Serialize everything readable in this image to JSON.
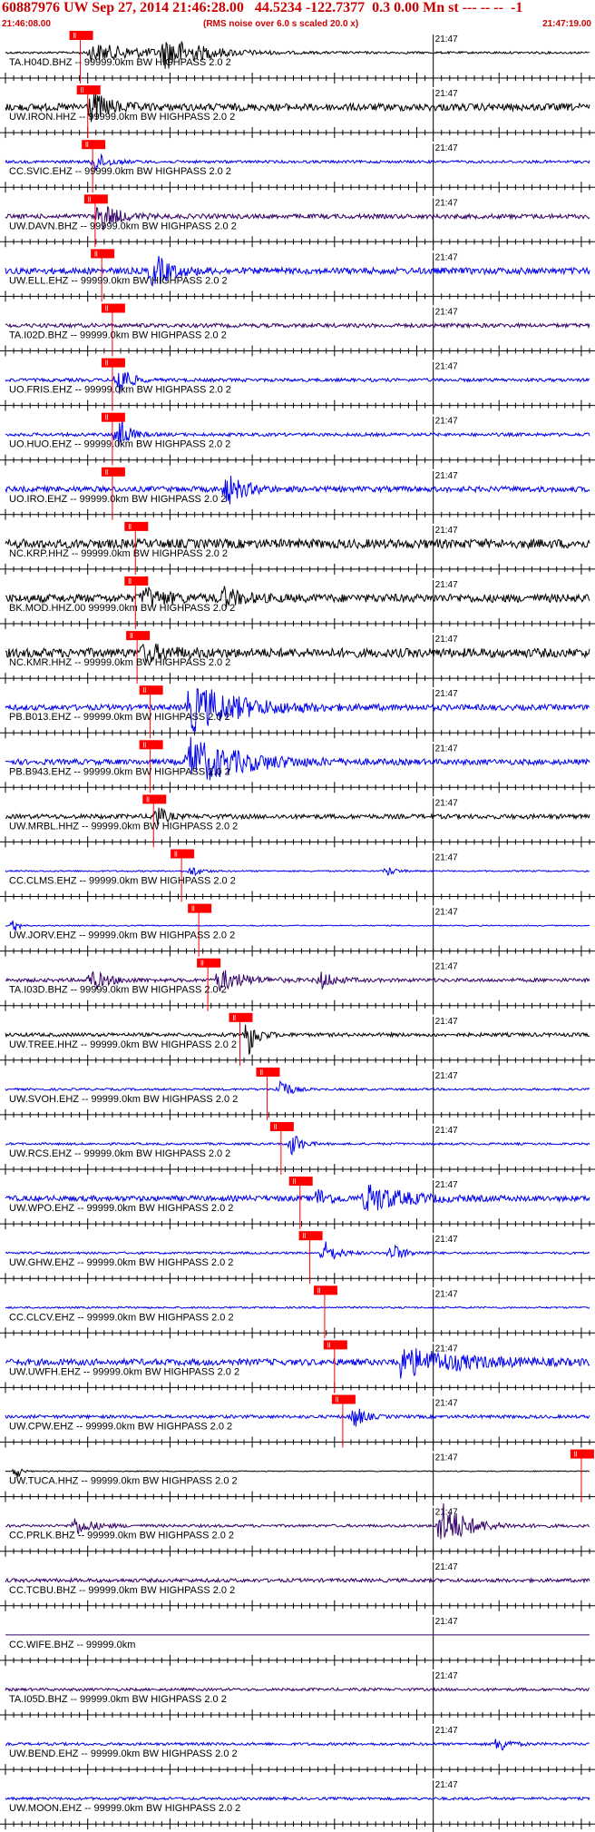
{
  "header": {
    "title": "60887976 UW Sep 27, 2014 21:46:28.00   44.5234 -122.7377  0.3 0.00 Mn st --- -- --  -1",
    "start_time": "21:46:08.00",
    "noise_note": "(RMS noise over 6.0 s scaled 20.0 x)",
    "end_time": "21:47:19.00",
    "minute_mark": "21:47",
    "pick_label": "ll"
  },
  "colors": {
    "black": "#000000",
    "blue": "#0000ee",
    "purple": "#330066",
    "pick": "#ff0000",
    "title": "#cc0000"
  },
  "chart_data": {
    "type": "line",
    "title": "60887976 UW Sep 27, 2014 21:46:28.00   44.5234 -122.7377  0.3 0.00 Mn st --- -- --  -1",
    "x_range": [
      "21:46:08.00",
      "21:47:19.00"
    ],
    "x_range_seconds": [
      0,
      71
    ],
    "tick_label": "21:47",
    "tick_label_seconds": 52,
    "series": [
      {
        "label": "TA.H04D.BHZ -- 99999.0km BW  HIGHPASS  2.0  2",
        "color": "black",
        "pick_s": 9.1,
        "amp": 0.12,
        "events": [
          [
            10.5,
            14,
            1.0
          ],
          [
            19.5,
            8,
            1.6
          ]
        ]
      },
      {
        "label": "UW.IRON.HHZ -- 99999.0km BW  HIGHPASS  2.0  2",
        "color": "black",
        "pick_s": 10.0,
        "amp": 0.4,
        "events": [
          [
            10.5,
            4,
            1.6
          ]
        ]
      },
      {
        "label": "CC.SVIC.EHZ -- 99999.0km BW  HIGHPASS  2.0  2",
        "color": "blue",
        "pick_s": 10.6,
        "amp": 0.15,
        "events": [
          [
            11.0,
            3,
            1.0
          ]
        ]
      },
      {
        "label": "UW.DAVN.BHZ -- 99999.0km BW  HIGHPASS  2.0  2",
        "color": "purple",
        "pick_s": 10.9,
        "amp": 0.25,
        "events": [
          [
            11.5,
            4,
            1.6
          ]
        ]
      },
      {
        "label": "UW.ELL.EHZ -- 99999.0km BW  HIGHPASS  2.0  2",
        "color": "blue",
        "pick_s": 11.7,
        "amp": 0.35,
        "events": [
          [
            18.0,
            4,
            1.8
          ]
        ]
      },
      {
        "label": "TA.I02D.BHZ -- 99999.0km BW  HIGHPASS  2.0  2",
        "color": "purple",
        "pick_s": 13.0,
        "amp": 0.22,
        "events": []
      },
      {
        "label": "UO.FRIS.EHZ -- 99999.0km BW  HIGHPASS  2.0  2",
        "color": "blue",
        "pick_s": 13.0,
        "amp": 0.18,
        "events": [
          [
            13.9,
            2,
            2.4
          ]
        ]
      },
      {
        "label": "UO.HUO.EHZ -- 99999.0km BW  HIGHPASS  2.0  2",
        "color": "blue",
        "pick_s": 13.0,
        "amp": 0.18,
        "events": [
          [
            13.8,
            2,
            2.4
          ]
        ]
      },
      {
        "label": "UO.IRO.EHZ -- 99999.0km BW  HIGHPASS  2.0  2",
        "color": "blue",
        "pick_s": 13.0,
        "amp": 0.3,
        "events": [
          [
            27.0,
            4,
            1.6
          ]
        ]
      },
      {
        "label": "NC.KRP.HHZ -- 99999.0km BW  HIGHPASS  2.0  2",
        "color": "black",
        "pick_s": 15.8,
        "amp": 0.5,
        "events": []
      },
      {
        "label": "BK.MOD.HHZ.00 99999.0km BW  HIGHPASS  2.0  2",
        "color": "black",
        "pick_s": 15.8,
        "amp": 0.45,
        "events": [
          [
            17.0,
            5,
            1.0
          ],
          [
            26.5,
            4,
            1.0
          ]
        ]
      },
      {
        "label": "NC.KMR.HHZ -- 99999.0km BW  HIGHPASS  2.0  2",
        "color": "black",
        "pick_s": 16.0,
        "amp": 0.5,
        "events": [
          [
            17.0,
            6,
            0.8
          ]
        ]
      },
      {
        "label": "PB.B013.EHZ -- 99999.0km BW  HIGHPASS  2.0  2",
        "color": "blue",
        "pick_s": 17.6,
        "amp": 0.3,
        "events": [
          [
            22.5,
            12,
            2.6
          ]
        ]
      },
      {
        "label": "PB.B943.EHZ -- 99999.0km BW  HIGHPASS  2.0  2",
        "color": "blue",
        "pick_s": 17.6,
        "amp": 0.3,
        "events": [
          [
            22.5,
            12,
            2.6
          ]
        ]
      },
      {
        "label": "UW.MRBL.HHZ -- 99999.0km BW  HIGHPASS  2.0  2",
        "color": "black",
        "pick_s": 18.0,
        "amp": 0.25,
        "events": [
          [
            18.4,
            2,
            1.2
          ]
        ]
      },
      {
        "label": "CC.CLMS.EHZ -- 99999.0km BW  HIGHPASS  2.0  2",
        "color": "blue",
        "pick_s": 21.4,
        "amp": 0.08,
        "events": [
          [
            22.8,
            2,
            0.6
          ],
          [
            46.5,
            2,
            0.5
          ]
        ]
      },
      {
        "label": "UW.JORV.EHZ -- 99999.0km BW  HIGHPASS  2.0  2",
        "color": "blue",
        "pick_s": 23.5,
        "amp": 0.06,
        "events": [
          [
            1.2,
            1,
            0.8
          ]
        ]
      },
      {
        "label": "TA.I03D.BHZ -- 99999.0km BW  HIGHPASS  2.0  2",
        "color": "purple",
        "pick_s": 24.6,
        "amp": 0.2,
        "events": [
          [
            10.5,
            4,
            1.0
          ],
          [
            26.0,
            6,
            1.2
          ],
          [
            38.5,
            3,
            0.9
          ]
        ]
      },
      {
        "label": "UW.TREE.HHZ -- 99999.0km BW  HIGHPASS  2.0  2",
        "color": "black",
        "pick_s": 28.5,
        "amp": 0.2,
        "events": [
          [
            29.5,
            2,
            2.4
          ]
        ]
      },
      {
        "label": "UW.SVOH.EHZ -- 99999.0km BW  HIGHPASS  2.0  2",
        "color": "blue",
        "pick_s": 31.8,
        "amp": 0.12,
        "events": [
          [
            33.5,
            2,
            1.4
          ]
        ]
      },
      {
        "label": "UW.RCS.EHZ -- 99999.0km BW  HIGHPASS  2.0  2",
        "color": "blue",
        "pick_s": 33.5,
        "amp": 0.12,
        "events": [
          [
            34.9,
            2,
            1.4
          ]
        ]
      },
      {
        "label": "UW.WPO.EHZ -- 99999.0km BW  HIGHPASS  2.0  2",
        "color": "blue",
        "pick_s": 35.8,
        "amp": 0.3,
        "events": [
          [
            44.0,
            8,
            1.6
          ],
          [
            38.0,
            3,
            1.0
          ]
        ]
      },
      {
        "label": "UW.GHW.EHZ -- 99999.0km BW  HIGHPASS  2.0  2",
        "color": "blue",
        "pick_s": 37.0,
        "amp": 0.12,
        "events": [
          [
            38.8,
            3,
            1.3
          ],
          [
            47.0,
            3,
            1.0
          ]
        ]
      },
      {
        "label": "CC.CLCV.EHZ -- 99999.0km BW  HIGHPASS  2.0  2",
        "color": "blue",
        "pick_s": 38.8,
        "amp": 0.1,
        "events": []
      },
      {
        "label": "UW.UWFH.EHZ -- 99999.0km BW  HIGHPASS  2.0  2",
        "color": "blue",
        "pick_s": 40.0,
        "amp": 0.35,
        "events": [
          [
            48.0,
            14,
            1.6
          ]
        ]
      },
      {
        "label": "UW.CPW.EHZ -- 99999.0km BW  HIGHPASS  2.0  2",
        "color": "blue",
        "pick_s": 41.0,
        "amp": 0.18,
        "events": [
          [
            42.5,
            2,
            1.3
          ]
        ]
      },
      {
        "label": "UW.TUCA.HHZ -- 99999.0km BW  HIGHPASS  2.0  2",
        "color": "black",
        "pick_s": 70.0,
        "amp": 0.05,
        "events": [
          [
            1.5,
            1,
            0.8
          ]
        ]
      },
      {
        "label": "CC.PRLK.BHZ -- 99999.0km BW  HIGHPASS  2.0  2",
        "color": "purple",
        "pick_s": null,
        "amp": 0.15,
        "events": [
          [
            8.5,
            4,
            1.0
          ],
          [
            53.0,
            6,
            2.6
          ]
        ]
      },
      {
        "label": "CC.TCBU.BHZ -- 99999.0km BW  HIGHPASS  2.0  2",
        "color": "purple",
        "pick_s": null,
        "amp": 0.2,
        "events": []
      },
      {
        "label": "CC.WIFE.BHZ -- 99999.0km",
        "color": "purple",
        "pick_s": null,
        "amp": 0.0,
        "events": []
      },
      {
        "label": "TA.I05D.BHZ -- 99999.0km BW  HIGHPASS  2.0  2",
        "color": "purple",
        "pick_s": null,
        "amp": 0.15,
        "events": []
      },
      {
        "label": "UW.BEND.EHZ -- 99999.0km BW  HIGHPASS  2.0  2",
        "color": "blue",
        "pick_s": null,
        "amp": 0.15,
        "events": [
          [
            60.0,
            2,
            1.0
          ]
        ]
      },
      {
        "label": "UW.MOON.EHZ -- 99999.0km BW  HIGHPASS  2.0  2",
        "color": "blue",
        "pick_s": null,
        "amp": 0.15,
        "events": []
      }
    ]
  }
}
